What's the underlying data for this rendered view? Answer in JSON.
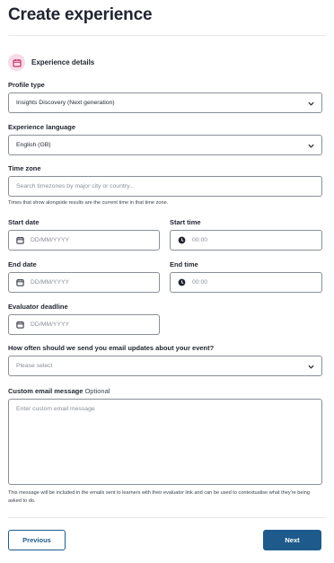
{
  "page": {
    "title": "Create experience"
  },
  "section": {
    "label": "Experience details",
    "icon": "calendar-icon",
    "icon_bg": "#f7dbe6",
    "icon_color": "#c8356b"
  },
  "profile_type": {
    "label": "Profile type",
    "value": "Insights Discovery (Next generation)"
  },
  "experience_language": {
    "label": "Experience language",
    "value": "English (GB)"
  },
  "time_zone": {
    "label": "Time zone",
    "placeholder": "Search timezones by major city or country...",
    "hint": "Times that show alongside results are the current time in that time zone."
  },
  "start_date": {
    "label": "Start date",
    "placeholder": "DD/MM/YYYY"
  },
  "start_time": {
    "label": "Start time",
    "placeholder": "00:00"
  },
  "end_date": {
    "label": "End date",
    "placeholder": "DD/MM/YYYY"
  },
  "end_time": {
    "label": "End time",
    "placeholder": "00:00"
  },
  "evaluator_deadline": {
    "label": "Evaluator deadline",
    "placeholder": "DD/MM/YYYY"
  },
  "email_updates": {
    "label": "How often should we send you email updates about your event?",
    "placeholder": "Please select"
  },
  "custom_message": {
    "label": "Custom email message",
    "optional": "Optional",
    "placeholder": "Enter custom email message",
    "hint": "This message will be included in the emails sent to learners with their evaluator link and can be used to contextualise what they're being asked to do."
  },
  "buttons": {
    "previous": "Previous",
    "next": "Next"
  },
  "colors": {
    "primary": "#1e5b8c",
    "border": "#8a8f98",
    "text": "#1f2430"
  }
}
